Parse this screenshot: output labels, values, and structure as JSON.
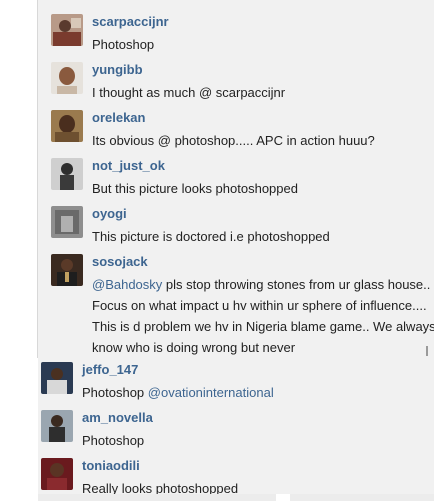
{
  "comments": [
    {
      "username": "scarpaccijnr",
      "text": "Photoshop",
      "avatar": "avatar-scarpaccijnr"
    },
    {
      "username": "yungibb",
      "text": "I thought as much @ scarpaccijnr",
      "avatar": "avatar-yungibb"
    },
    {
      "username": "orelekan",
      "text": "Its obvious @ photoshop..... APC in action huuu?",
      "avatar": "avatar-orelekan"
    },
    {
      "username": "not_just_ok",
      "text": "But this picture looks photoshopped",
      "avatar": "avatar-not-just-ok"
    },
    {
      "username": "oyogi",
      "text": "This picture is doctored i.e photoshopped",
      "avatar": "avatar-oyogi"
    },
    {
      "username": "sosojack",
      "mention": "@Bahdosky",
      "text": " pls stop throwing stones from ur glass house.. Focus on what impact u hv within ur sphere of influence.... This is d problem we hv in Nigeria blame game.. We always know who is doing wrong but never",
      "avatar": "avatar-sosojack"
    },
    {
      "username": "jeffo_147",
      "text": "Photoshop ",
      "mention": "@ovationinternational",
      "avatar": "avatar-jeffo-147"
    },
    {
      "username": "am_novella",
      "text": "Photoshop",
      "avatar": "avatar-am-novella"
    },
    {
      "username": "toniaodili",
      "text": "Really looks photoshopped",
      "avatar": "avatar-toniaodili"
    }
  ],
  "colors": {
    "username": "#3d6590",
    "mention": "#3d6590",
    "text": "#222222",
    "panel_background": "#f1f1f1"
  }
}
